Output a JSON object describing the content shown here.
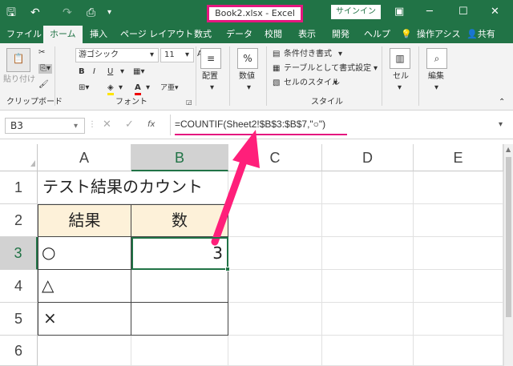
{
  "window": {
    "title": "Book2.xlsx  -  Excel",
    "signin_label": "サインイン"
  },
  "quick_access": {
    "save_icon": "save-icon",
    "undo_icon": "undo-icon",
    "redo_icon": "redo-icon",
    "print_preview_icon": "print-preview-icon"
  },
  "tabs": [
    "ファイル",
    "ホーム",
    "挿入",
    "ページ レイアウト",
    "数式",
    "データ",
    "校閲",
    "表示",
    "開発",
    "ヘルプ",
    "操作アシス",
    "共有"
  ],
  "active_tab": "ホーム",
  "ribbon": {
    "clipboard": {
      "paste_label": "貼り付け",
      "group_label": "クリップボード"
    },
    "font": {
      "font_name": "游ゴシック",
      "font_size": "11",
      "bold": "B",
      "italic": "I",
      "underline": "U",
      "grow": "A",
      "shrink": "A",
      "group_label": "フォント"
    },
    "alignment": {
      "label": "配置"
    },
    "number": {
      "label": "数値",
      "icon_text": "%"
    },
    "styles": {
      "conditional": "条件付き書式",
      "table": "テーブルとして書式設定",
      "cell_styles": "セルのスタイル",
      "group_label": "スタイル"
    },
    "cells": {
      "label": "セル"
    },
    "editing": {
      "label": "編集"
    }
  },
  "formula_bar": {
    "name_box": "B3",
    "fx": "fx",
    "formula": "=COUNTIF(Sheet2!$B$3:$B$7,\"○\")"
  },
  "columns": [
    "A",
    "B",
    "C",
    "D",
    "E"
  ],
  "rows": [
    "1",
    "2",
    "3",
    "4",
    "5",
    "6"
  ],
  "cells": {
    "A1": "テスト結果のカウント",
    "A2": "結果",
    "B2": "数",
    "A3": "○",
    "B3": "3",
    "A4": "△",
    "A5": "×"
  },
  "colors": {
    "excel_green": "#217346",
    "highlight_pink": "#e5177f",
    "header_fill": "#fdf1d9"
  }
}
